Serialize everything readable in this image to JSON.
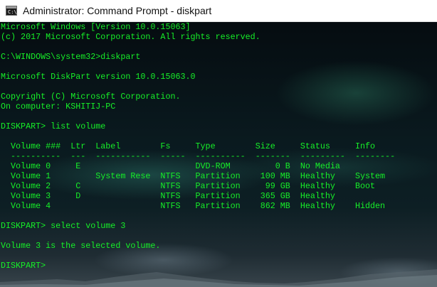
{
  "window": {
    "title": "Administrator: Command Prompt - diskpart",
    "icon": "command-prompt-icon",
    "icon_glyph": "C:\\"
  },
  "theme": {
    "text_color": "#16f028",
    "titlebar_bg": "#ffffff"
  },
  "console": {
    "lines": [
      "Microsoft Windows [Version 10.0.15063]",
      "(c) 2017 Microsoft Corporation. All rights reserved.",
      "",
      "C:\\WINDOWS\\system32>diskpart",
      "",
      "Microsoft DiskPart version 10.0.15063.0",
      "",
      "Copyright (C) Microsoft Corporation.",
      "On computer: KSHITIJ-PC",
      "",
      "DISKPART> list volume",
      "",
      "  Volume ###  Ltr  Label        Fs     Type        Size     Status     Info",
      "  ----------  ---  -----------  -----  ----------  -------  ---------  --------",
      "  Volume 0     E                       DVD-ROM         0 B  No Media",
      "  Volume 1         System Rese  NTFS   Partition    100 MB  Healthy    System",
      "  Volume 2     C                NTFS   Partition     99 GB  Healthy    Boot",
      "  Volume 3     D                NTFS   Partition    365 GB  Healthy",
      "  Volume 4                      NTFS   Partition    862 MB  Healthy    Hidden",
      "",
      "DISKPART> select volume 3",
      "",
      "Volume 3 is the selected volume.",
      "",
      "DISKPART> "
    ]
  }
}
